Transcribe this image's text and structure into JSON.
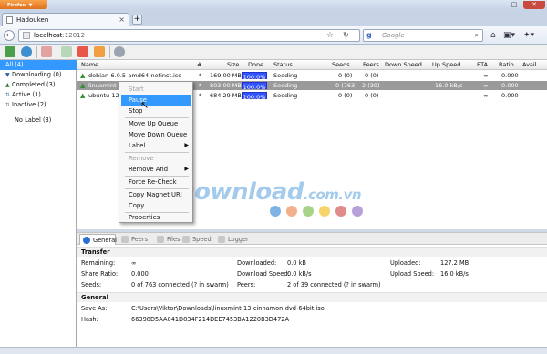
{
  "browser": {
    "menu_label": "Firefox",
    "tab_title": "Hadouken",
    "url_host": "localhost",
    "url_port": ":12012",
    "search_engine": "g",
    "search_placeholder": "Google"
  },
  "sidebar": {
    "items": [
      {
        "label": "All (4)"
      },
      {
        "label": "Downloading (0)"
      },
      {
        "label": "Completed (3)"
      },
      {
        "label": "Active (1)"
      },
      {
        "label": "Inactive (2)"
      },
      {
        "label": "No Label (3)"
      }
    ]
  },
  "list": {
    "headers": {
      "name": "Name",
      "num": "#",
      "size": "Size",
      "done": "Done",
      "status": "Status",
      "seeds": "Seeds",
      "peers": "Peers",
      "down_speed": "Down Speed",
      "up_speed": "Up Speed",
      "eta": "ETA",
      "ratio": "Ratio",
      "avail": "Avail."
    },
    "rows": [
      {
        "name": "debian-6.0.5-amd64-netinst.iso",
        "num": "*",
        "size": "169.00 MB",
        "done": "100.0%",
        "status": "Seeding",
        "seeds": "0 (0)",
        "peers": "0 (0)",
        "down": "",
        "up": "",
        "eta": "∞",
        "ratio": "0.000"
      },
      {
        "name": "linuxmint-1",
        "num": "*",
        "size": "803.00 MB",
        "done": "100.0%",
        "status": "Seeding",
        "seeds": "0 (763)",
        "peers": "2 (39)",
        "down": "",
        "up": "16.0 kB/s",
        "eta": "∞",
        "ratio": "0.000"
      },
      {
        "name": "ubuntu-12.",
        "num": "*",
        "size": "684.29 MB",
        "done": "100.0%",
        "status": "Seeding",
        "seeds": "0 (0)",
        "peers": "0 (0)",
        "down": "",
        "up": "",
        "eta": "∞",
        "ratio": "0.000"
      }
    ]
  },
  "context_menu": {
    "items": [
      {
        "label": "Start"
      },
      {
        "label": "Pause"
      },
      {
        "label": "Stop"
      },
      {
        "label": "Move Up Queue"
      },
      {
        "label": "Move Down Queue"
      },
      {
        "label": "Label"
      },
      {
        "label": "Remove"
      },
      {
        "label": "Remove And"
      },
      {
        "label": "Force Re-Check"
      },
      {
        "label": "Copy Magnet URI"
      },
      {
        "label": "Copy"
      },
      {
        "label": "Properties"
      }
    ],
    "submenu_arrow": "▶"
  },
  "watermark": {
    "main": "Download",
    "suffix": ".com.vn"
  },
  "watermark_dots": [
    "#7fb2e5",
    "#f2b08c",
    "#a8d48a",
    "#f5d56b",
    "#e28b8b",
    "#b8a0d8"
  ],
  "details": {
    "tabs": [
      {
        "label": "General"
      },
      {
        "label": "Peers"
      },
      {
        "label": "Files"
      },
      {
        "label": "Speed"
      },
      {
        "label": "Logger"
      }
    ],
    "transfer_title": "Transfer",
    "general_title": "General",
    "remaining_label": "Remaining:",
    "remaining_value": "∞",
    "share_label": "Share Ratio:",
    "share_value": "0.000",
    "seeds_label": "Seeds:",
    "seeds_value": "0 of 763 connected (? in swarm)",
    "downloaded_label": "Downloaded:",
    "downloaded_value": "0.0 kB",
    "dlspeed_label": "Download Speed:",
    "dlspeed_value": "0.0 kB/s",
    "peers_label": "Peers:",
    "peers_value": "2 of 39 connected (? in swarm)",
    "uploaded_label": "Uploaded:",
    "uploaded_value": "127.2 MB",
    "ulspeed_label": "Upload Speed:",
    "ulspeed_value": "16.0 kB/s",
    "saveas_label": "Save As:",
    "saveas_value": "C:\\Users\\Viktor\\Downloads\\linuxmint-13-cinnamon-dvd-64bit.iso",
    "hash_label": "Hash:",
    "hash_value": "66398D5AA041D834F214DEE7453BA1220B3D472A"
  }
}
